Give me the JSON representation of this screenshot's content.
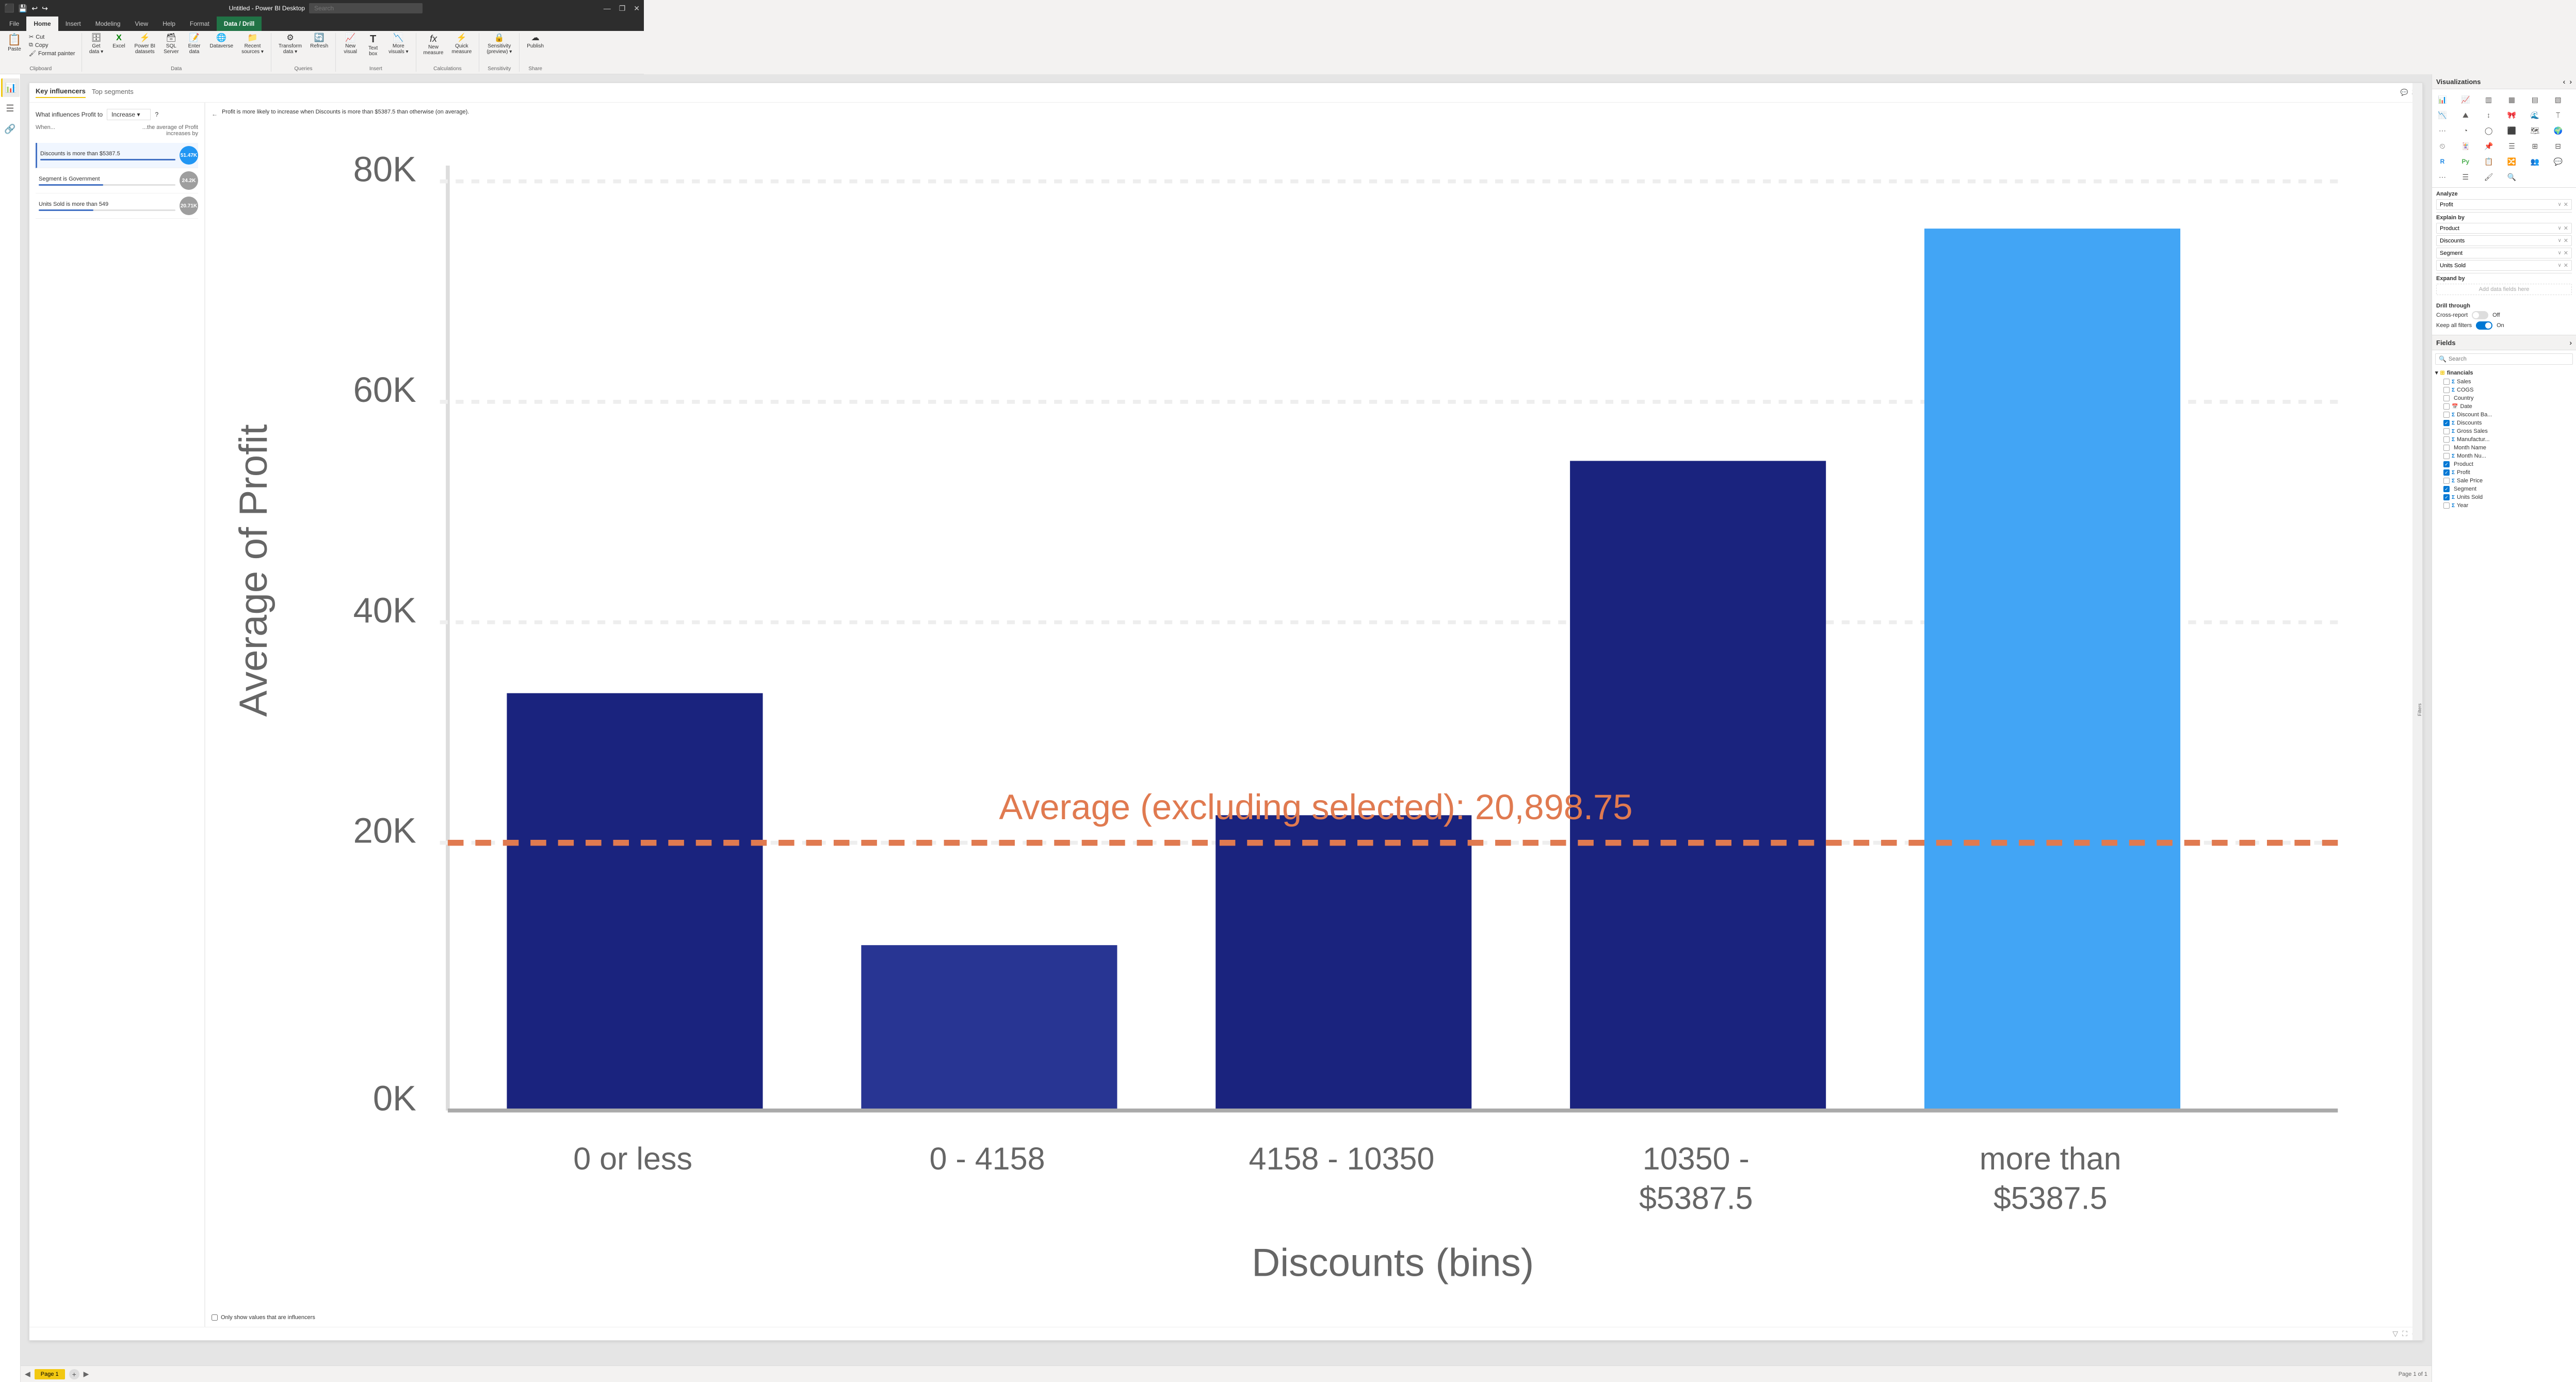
{
  "titleBar": {
    "title": "Untitled - Power BI Desktop",
    "searchPlaceholder": "Search",
    "winBtns": [
      "—",
      "❐",
      "✕"
    ]
  },
  "ribbonTabs": [
    {
      "id": "file",
      "label": "File",
      "active": false
    },
    {
      "id": "home",
      "label": "Home",
      "active": true
    },
    {
      "id": "insert",
      "label": "Insert",
      "active": false
    },
    {
      "id": "modeling",
      "label": "Modeling",
      "active": false
    },
    {
      "id": "view",
      "label": "View",
      "active": false
    },
    {
      "id": "help",
      "label": "Help",
      "active": false
    },
    {
      "id": "format",
      "label": "Format",
      "active": false
    },
    {
      "id": "data_drill",
      "label": "Data / Drill",
      "active": false,
      "highlighted": true
    }
  ],
  "ribbon": {
    "sections": [
      {
        "id": "clipboard",
        "label": "Clipboard",
        "items": [
          {
            "id": "paste",
            "icon": "📋",
            "label": "Paste",
            "big": true
          },
          {
            "id": "cut",
            "icon": "✂",
            "label": "Cut",
            "small": true
          },
          {
            "id": "copy",
            "icon": "⧉",
            "label": "Copy",
            "small": true
          },
          {
            "id": "format_painter",
            "icon": "🖌",
            "label": "Format painter",
            "small": true
          }
        ]
      },
      {
        "id": "data",
        "label": "Data",
        "items": [
          {
            "id": "get_data",
            "icon": "🗄",
            "label": "Get data ▾",
            "big": false
          },
          {
            "id": "excel",
            "icon": "📊",
            "label": "Excel",
            "big": false
          },
          {
            "id": "power_bi",
            "icon": "⚡",
            "label": "Power BI datasets",
            "big": false
          },
          {
            "id": "sql",
            "icon": "🗃",
            "label": "SQL Server",
            "big": false
          },
          {
            "id": "enter_data",
            "icon": "📝",
            "label": "Enter data",
            "big": false
          },
          {
            "id": "dataverse",
            "icon": "🌐",
            "label": "Dataverse",
            "big": false
          },
          {
            "id": "recent",
            "icon": "📁",
            "label": "Recent sources ▾",
            "big": false
          }
        ]
      },
      {
        "id": "queries",
        "label": "Queries",
        "items": [
          {
            "id": "transform",
            "icon": "⚙",
            "label": "Transform data ▾",
            "big": false
          },
          {
            "id": "refresh",
            "icon": "🔄",
            "label": "Refresh",
            "big": false
          }
        ]
      },
      {
        "id": "insert",
        "label": "Insert",
        "items": [
          {
            "id": "new_visual",
            "icon": "📈",
            "label": "New visual",
            "big": false
          },
          {
            "id": "text_box",
            "icon": "T",
            "label": "Text box",
            "big": false
          },
          {
            "id": "more_visuals",
            "icon": "📉",
            "label": "More visuals ▾",
            "big": false
          }
        ]
      },
      {
        "id": "calculations",
        "label": "Calculations",
        "items": [
          {
            "id": "new_measure",
            "icon": "fx",
            "label": "New measure",
            "big": false
          },
          {
            "id": "quick_measure",
            "icon": "⚡",
            "label": "Quick measure",
            "big": false
          }
        ]
      },
      {
        "id": "sensitivity",
        "label": "Sensitivity",
        "items": [
          {
            "id": "sensitivity_preview",
            "icon": "🔒",
            "label": "Sensitivity (preview) ▾",
            "big": false
          }
        ]
      },
      {
        "id": "share",
        "label": "Share",
        "items": [
          {
            "id": "publish",
            "icon": "☁",
            "label": "Publish",
            "big": false
          }
        ]
      }
    ]
  },
  "visual": {
    "tabs": [
      "Key influencers",
      "Top segments"
    ],
    "activeTab": 0,
    "question": {
      "prefix": "What influences Profit to",
      "dropdown": "Increase",
      "suffix": "?"
    },
    "whenLabel": "When...",
    "avgLabel": "...the average of Profit increases by",
    "influencers": [
      {
        "id": "discounts",
        "label": "Discounts is more than $5387.5",
        "value": "51.47K",
        "isBlue": true,
        "barWidth": 100
      },
      {
        "id": "segment",
        "label": "Segment is Government",
        "value": "24.2K",
        "isBlue": false,
        "barWidth": 47
      },
      {
        "id": "units_sold",
        "label": "Units Sold is more than 549",
        "value": "20.71K",
        "isBlue": false,
        "barWidth": 40
      }
    ],
    "chartTitle": "Profit is more likely to increase when Discounts is more than $5387.5 than otherwise (on average).",
    "chart": {
      "yLabel": "Average of Profit",
      "xLabel": "Discounts (bins)",
      "avgLine": "Average (excluding selected): 20,898.75",
      "bars": [
        {
          "label": "0 or less",
          "height": 45,
          "color": "#1a237e"
        },
        {
          "label": "0 - 4158",
          "height": 18,
          "color": "#283593"
        },
        {
          "label": "4158 - 10350",
          "height": 32,
          "color": "#1a237e"
        },
        {
          "label": "10350 - $5387.5",
          "height": 70,
          "color": "#1a237e"
        },
        {
          "label": "more than $5387.5",
          "height": 95,
          "color": "#42a5f5"
        }
      ],
      "yTicks": [
        "80K",
        "60K",
        "40K",
        "20K",
        "0K"
      ],
      "checkboxLabel": "Only show values that are influencers"
    }
  },
  "visualizations": {
    "title": "Visualizations",
    "analyzeLabel": "Analyze",
    "explainByLabel": "Explain by",
    "expandByLabel": "Expand by",
    "drillThroughLabel": "Drill through",
    "crossReportLabel": "Cross-report",
    "keepAllFiltersLabel": "Keep all filters",
    "addFieldPlaceholder": "Add data fields here",
    "analyzeFields": [
      {
        "name": "Profit",
        "removable": true
      }
    ],
    "explainByFields": [
      {
        "name": "Product",
        "removable": true
      },
      {
        "name": "Discounts",
        "removable": true
      },
      {
        "name": "Segment",
        "removable": true
      },
      {
        "name": "Units Sold",
        "removable": true
      }
    ],
    "crossReportOff": true,
    "keepFiltersOn": true
  },
  "fields": {
    "title": "Fields",
    "searchPlaceholder": "Search",
    "tables": [
      {
        "name": "financials",
        "expanded": true,
        "fields": [
          {
            "name": "Sales",
            "type": "Σ",
            "checked": false
          },
          {
            "name": "COGS",
            "type": "Σ",
            "checked": false
          },
          {
            "name": "Country",
            "type": "",
            "checked": false
          },
          {
            "name": "Date",
            "type": "📅",
            "checked": false,
            "isDate": true
          },
          {
            "name": "Discount Ba...",
            "type": "Σ",
            "checked": false
          },
          {
            "name": "Discounts",
            "type": "Σ",
            "checked": true
          },
          {
            "name": "Gross Sales",
            "type": "Σ",
            "checked": false
          },
          {
            "name": "Manufactur...",
            "type": "Σ",
            "checked": false
          },
          {
            "name": "Month Name",
            "type": "",
            "checked": false
          },
          {
            "name": "Month Nu...",
            "type": "Σ",
            "checked": false
          },
          {
            "name": "Product",
            "type": "",
            "checked": true
          },
          {
            "name": "Profit",
            "type": "Σ",
            "checked": true
          },
          {
            "name": "Sale Price",
            "type": "Σ",
            "checked": false
          },
          {
            "name": "Segment",
            "type": "",
            "checked": true
          },
          {
            "name": "Units Sold",
            "type": "Σ",
            "checked": true
          },
          {
            "name": "Year",
            "type": "Σ",
            "checked": false
          }
        ]
      }
    ]
  },
  "pages": [
    {
      "name": "Page 1",
      "active": true
    }
  ],
  "statusBar": {
    "text": "Page 1 of 1"
  },
  "filters": "Filters"
}
